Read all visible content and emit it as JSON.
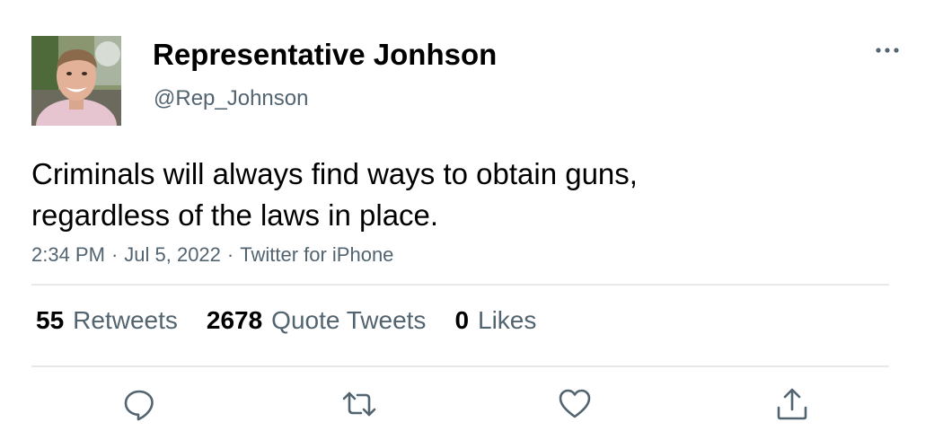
{
  "author": {
    "display_name": "Representative Jonhson",
    "handle": "@Rep_Johnson"
  },
  "tweet": {
    "text_line1": "Criminals will always find ways to obtain guns,",
    "text_line2": "regardless of the laws in place.",
    "time": "2:34 PM",
    "date": "Jul 5, 2022",
    "source": "Twitter for iPhone",
    "separator": "·"
  },
  "stats": {
    "retweets_count": "55",
    "retweets_label": "Retweets",
    "quotes_count": "2678",
    "quotes_label": "Quote Tweets",
    "likes_count": "0",
    "likes_label": "Likes"
  },
  "icons": {
    "more": "more-options-icon",
    "reply": "reply-icon",
    "retweet": "retweet-icon",
    "like": "like-icon",
    "share": "share-icon"
  },
  "colors": {
    "secondary_text": "#536471",
    "primary_text": "#000000",
    "divider": "#e6e8ea",
    "icon": "#536471"
  }
}
